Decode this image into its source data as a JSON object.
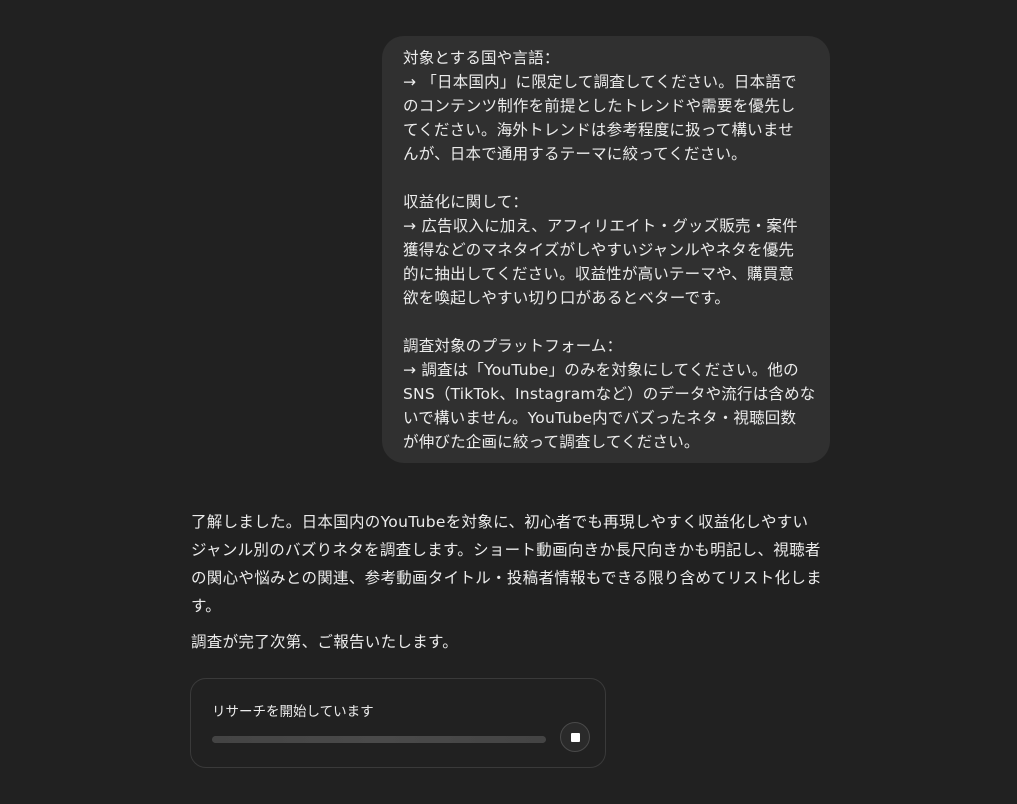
{
  "user_message": {
    "lines": [
      "対象とする国や言語：",
      "→ 「日本国内」に限定して調査してください。日本語で",
      "のコンテンツ制作を前提としたトレンドや需要を優先し",
      "てください。海外トレンドは参考程度に扱って構いませ",
      "んが、日本で通用するテーマに絞ってください。",
      "",
      "収益化に関して：",
      "→ 広告収入に加え、アフィリエイト・グッズ販売・案件",
      "獲得などのマネタイズがしやすいジャンルやネタを優先",
      "的に抽出してください。収益性が高いテーマや、購買意",
      "欲を喚起しやすい切り口があるとベターです。",
      "",
      "調査対象のプラットフォーム：",
      "→ 調査は「YouTube」のみを対象にしてください。他の",
      "SNS（TikTok、Instagramなど）のデータや流行は含めな",
      "いで構いません。YouTube内でバズったネタ・視聴回数",
      "が伸びた企画に絞って調査してください。"
    ]
  },
  "assistant_message": {
    "paragraph_1_lines": [
      "了解しました。日本国内のYouTubeを対象に、初心者でも再現しやすく収益化しやすい",
      "ジャンル別のバズりネタを調査します。ショート動画向きか長尺向きかも明記し、視聴者",
      "の関心や悩みとの関連、参考動画タイトル・投稿者情報もできる限り含めてリスト化しま",
      "す。"
    ],
    "paragraph_2": "調査が完了次第、ご報告いたします。"
  },
  "research_card": {
    "status_label": "リサーチを開始しています",
    "progress": 1.0,
    "stop_icon": "stop-icon"
  }
}
